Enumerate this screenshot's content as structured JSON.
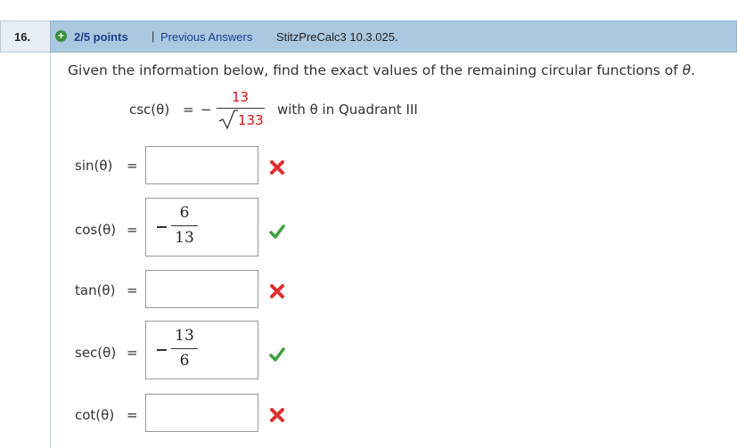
{
  "header": {
    "question_number": "16.",
    "points": "2/5 points",
    "separator": "|",
    "previous_answers": "Previous Answers",
    "source": "StitzPreCalc3 10.3.025."
  },
  "prompt": {
    "text_before": "Given the information below, find the exact values of the remaining circular functions of ",
    "theta": "θ",
    "text_after": "."
  },
  "given": {
    "function": "csc(θ)",
    "equals": "=",
    "sign": "−",
    "numerator": "13",
    "denominator": "133",
    "condition": "with θ in Quadrant III"
  },
  "rows": [
    {
      "label": "sin(θ)",
      "equals": "=",
      "status": "incorrect",
      "answer": null
    },
    {
      "label": "cos(θ)",
      "equals": "=",
      "status": "correct",
      "answer": {
        "numerator": "6",
        "denominator": "13",
        "negative": true
      }
    },
    {
      "label": "tan(θ)",
      "equals": "=",
      "status": "incorrect",
      "answer": null
    },
    {
      "label": "sec(θ)",
      "equals": "=",
      "status": "correct",
      "answer": {
        "numerator": "13",
        "denominator": "6",
        "negative": true
      }
    },
    {
      "label": "cot(θ)",
      "equals": "=",
      "status": "incorrect",
      "answer": null
    }
  ],
  "colors": {
    "header_bg": "#aac8e0",
    "link": "#1c3e8c",
    "highlight_red": "#dd1111",
    "correct_green": "#3ca03c",
    "incorrect_red": "#e03030"
  },
  "icons": {
    "plus": "plus-circle-icon",
    "correct": "check-icon",
    "incorrect": "x-icon"
  }
}
